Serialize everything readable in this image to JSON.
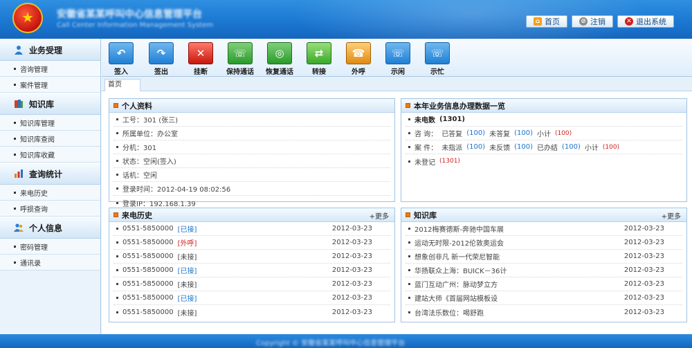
{
  "header": {
    "system_title": "安徽省某某呼叫中心信息管理平台",
    "system_subtitle": "Call Center Information Management System",
    "links": [
      {
        "label": "首页",
        "icon": "home-icon"
      },
      {
        "label": "注销",
        "icon": "logout-icon"
      },
      {
        "label": "退出系统",
        "icon": "exit-icon"
      }
    ]
  },
  "sidebar": {
    "sections": [
      {
        "title": "业务受理",
        "icon": "person-icon",
        "items": [
          "咨询管理",
          "案件管理"
        ]
      },
      {
        "title": "知识库",
        "icon": "book-icon",
        "items": [
          "知识库管理",
          "知识库查阅",
          "知识库收藏"
        ]
      },
      {
        "title": "查询统计",
        "icon": "bar-chart-icon",
        "items": [
          "来电历史",
          "呼损查询"
        ]
      },
      {
        "title": "个人信息",
        "icon": "user-group-icon",
        "items": [
          "密码管理",
          "通讯录"
        ]
      }
    ]
  },
  "toolbar": {
    "tools": [
      {
        "label": "签入",
        "icon": "sign-in-icon",
        "glyph": "↶"
      },
      {
        "label": "签出",
        "icon": "sign-out-icon",
        "glyph": "↷"
      },
      {
        "label": "挂断",
        "icon": "hang-up-icon",
        "glyph": "✕"
      },
      {
        "label": "保持通话",
        "icon": "hold-call-icon",
        "glyph": "☏"
      },
      {
        "label": "恢复通话",
        "icon": "resume-call-icon",
        "glyph": "◎"
      },
      {
        "label": "转接",
        "icon": "transfer-icon",
        "glyph": "⇄"
      },
      {
        "label": "外呼",
        "icon": "outbound-call-icon",
        "glyph": "☎"
      },
      {
        "label": "示闲",
        "icon": "idle-status-icon",
        "glyph": "☏"
      },
      {
        "label": "示忙",
        "icon": "busy-status-icon",
        "glyph": "☏"
      }
    ]
  },
  "tabs": [
    {
      "label": "首页"
    }
  ],
  "profile": {
    "title": "个人资料",
    "rows": [
      "工号：301 (张三)",
      "所属单位：办公室",
      "分机：301",
      "状态：空闲(签入)",
      "话机：空闲",
      "登录时间：2012-04-19 08:02:56",
      "登录IP：192.168.1.39"
    ]
  },
  "business": {
    "title": "本年业务信息办理数据一览",
    "missed": {
      "label": "未电数",
      "count": "(1301)"
    },
    "consult": {
      "label": "咨 询：",
      "answered_label": "已答复",
      "answered": "(100)",
      "unanswered_label": "未答复",
      "unanswered": "(100)",
      "subtotal_label": "小计",
      "subtotal": "(100)"
    },
    "case": {
      "label": "案 件：",
      "unassigned_label": "未指派",
      "unassigned": "(100)",
      "nofeedback_label": "未反馈",
      "nofeedback": "(100)",
      "closed_label": "已办结",
      "closed": "(100)",
      "subtotal_label": "小计",
      "subtotal": "(100)"
    },
    "unregistered": {
      "label": "未登记",
      "count": "(1301)"
    }
  },
  "call_history": {
    "title": "来电历史",
    "more": "+更多",
    "rows": [
      {
        "phone": "0551-5850000",
        "status": "[已接]",
        "status_type": "answered",
        "date": "2012-03-23"
      },
      {
        "phone": "0551-5850000",
        "status": "[外呼]",
        "status_type": "outbound",
        "date": "2012-03-23"
      },
      {
        "phone": "0551-5850000",
        "status": "[未接]",
        "status_type": "missed",
        "date": "2012-03-23"
      },
      {
        "phone": "0551-5850000",
        "status": "[已接]",
        "status_type": "answered",
        "date": "2012-03-23"
      },
      {
        "phone": "0551-5850000",
        "status": "[未接]",
        "status_type": "missed",
        "date": "2012-03-23"
      },
      {
        "phone": "0551-5850000",
        "status": "[已接]",
        "status_type": "answered",
        "date": "2012-03-23"
      },
      {
        "phone": "0551-5850000",
        "status": "[未接]",
        "status_type": "missed",
        "date": "2012-03-23"
      }
    ]
  },
  "knowledge": {
    "title": "知识库",
    "more": "+更多",
    "rows": [
      {
        "text": "2012梅赛德斯-奔驰中国车展",
        "date": "2012-03-23"
      },
      {
        "text": "运动无时限-2012伦敦奥运会",
        "date": "2012-03-23"
      },
      {
        "text": "想象创非凡 新一代荣尼智能",
        "date": "2012-03-23"
      },
      {
        "text": "华扬联众上海：BUICK－36计",
        "date": "2012-03-23"
      },
      {
        "text": "蓝门互动广州：脉动梦立方",
        "date": "2012-03-23"
      },
      {
        "text": "建站大师《首届网站模板设",
        "date": "2012-03-23"
      },
      {
        "text": "台湾法乐数位：喝舒跑",
        "date": "2012-03-23"
      }
    ]
  },
  "footer": {
    "text": "Copyright © 安徽省某某呼叫中心信息管理平台"
  },
  "colors": {
    "accent": "#1b78d2",
    "link_blue": "#1a72c8",
    "alert_red": "#d0201c"
  }
}
